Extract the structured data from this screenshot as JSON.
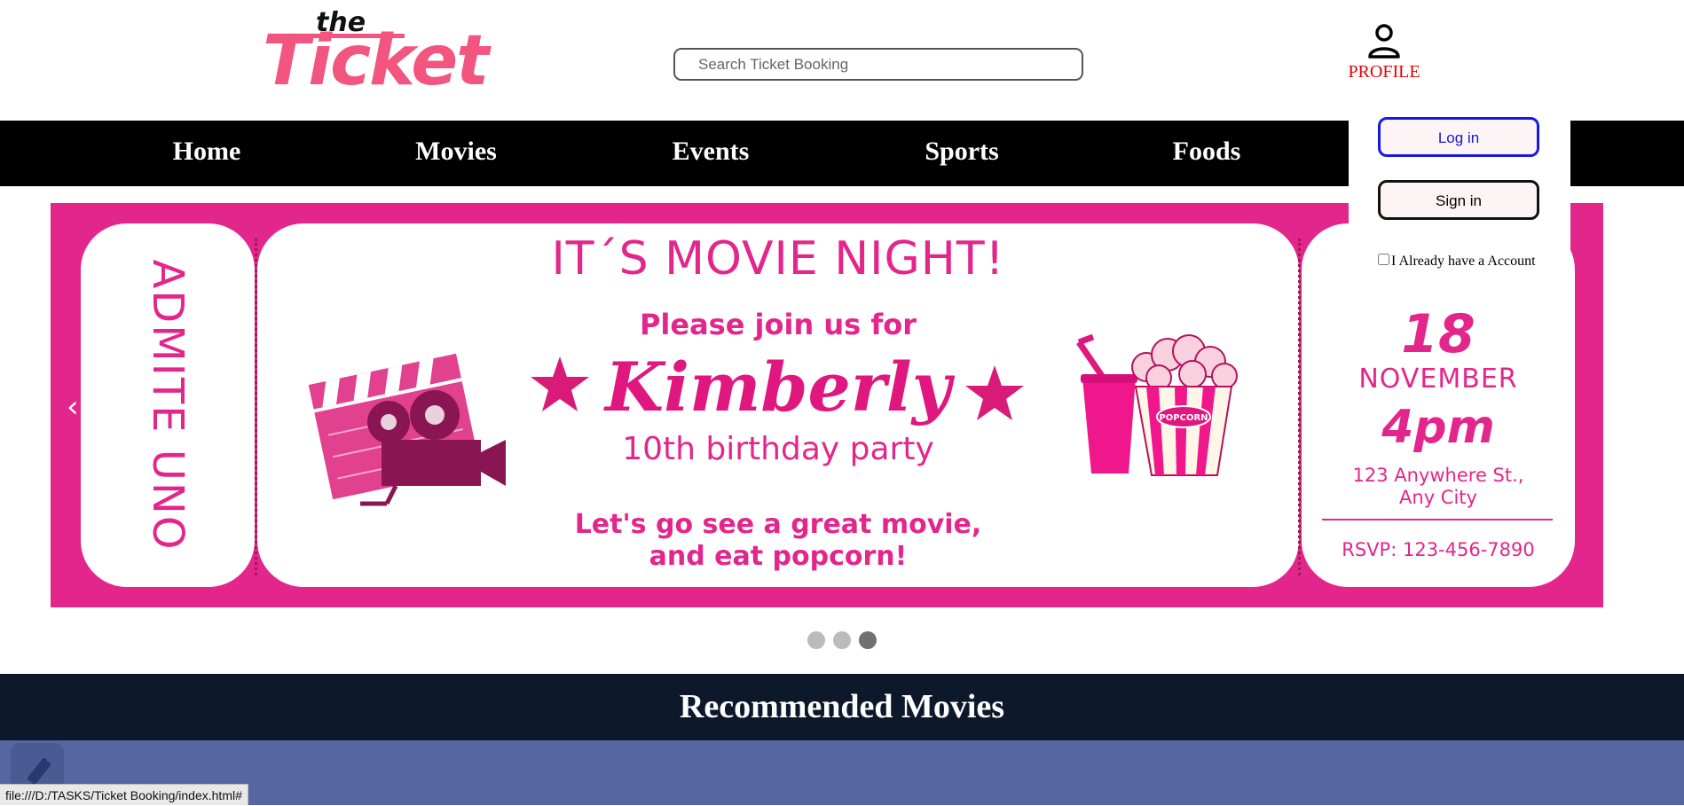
{
  "header": {
    "logo_top": "the",
    "logo_main": "Ticket",
    "search_placeholder": "Search Ticket Booking",
    "profile_label": "PROFILE",
    "profile_icon": "person-icon"
  },
  "nav": {
    "items": [
      {
        "label": "Home"
      },
      {
        "label": "Movies"
      },
      {
        "label": "Events"
      },
      {
        "label": "Sports"
      },
      {
        "label": "Foods"
      }
    ]
  },
  "profile_dropdown": {
    "login_label": "Log in",
    "signin_label": "Sign in",
    "checkbox_label": "I Already have a Account",
    "checkbox_checked": false
  },
  "carousel": {
    "prev_label": "‹",
    "slide": {
      "stub_text": "ADMITE UNO",
      "headline": "IT´S MOVIE NIGHT!",
      "invite_line": "Please join us for",
      "name": "Kimberly",
      "occasion": "10th birthday party",
      "message": "Let's go see a great movie,\nand eat popcorn!",
      "day": "18",
      "month": "NOVEMBER",
      "time": "4pm",
      "address": "123 Anywhere St.,\nAny City",
      "rsvp": "RSVP: 123-456-7890",
      "popcorn_label": "POPCORN"
    },
    "dots_count": 3,
    "active_dot": 3
  },
  "sections": {
    "recommended_title": "Recommended Movies"
  },
  "status_bar": {
    "url": "file:///D:/TASKS/Ticket Booking/index.html#"
  },
  "colors": {
    "brand_pink": "#e3268c",
    "logo_pink": "#f2557f",
    "nav_bg": "#000000",
    "section_bg": "#0d192b",
    "profile_red": "#e00000"
  }
}
